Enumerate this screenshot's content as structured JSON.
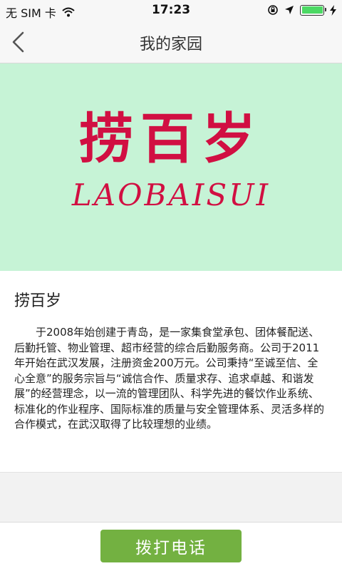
{
  "status_bar": {
    "carrier": "无 SIM 卡",
    "time": "17:23",
    "battery_level": 1.0,
    "icons": [
      "wifi-icon",
      "orientation-lock-icon",
      "location-arrow-icon",
      "battery-icon",
      "charging-icon"
    ]
  },
  "nav": {
    "title": "我的家园",
    "back_icon": "chevron-left-icon"
  },
  "banner": {
    "logo_cn": "捞百岁",
    "logo_en": "LAOBAISUI",
    "background_color": "#c6f3d6",
    "logo_color": "#d10f42"
  },
  "content": {
    "company_name": "捞百岁",
    "description": "于2008年始创建于青岛，是一家集食堂承包、团体餐配送、后勤托管、物业管理、超市经营的综合后勤服务商。公司于2011年开始在武汉发展，注册资金200万元。公司秉持“至诚至信、全心全意”的服务宗旨与“诚信合作、质量求存、追求卓越、和谐发展”的经营理念，以一流的管理团队、科学先进的餐饮作业系统、标准化的作业程序、国际标准的质量与安全管理体系、灵活多样的合作模式，在武汉取得了比较理想的业绩。"
  },
  "bottom": {
    "call_button_label": "拨打电话",
    "button_color": "#73b141"
  }
}
